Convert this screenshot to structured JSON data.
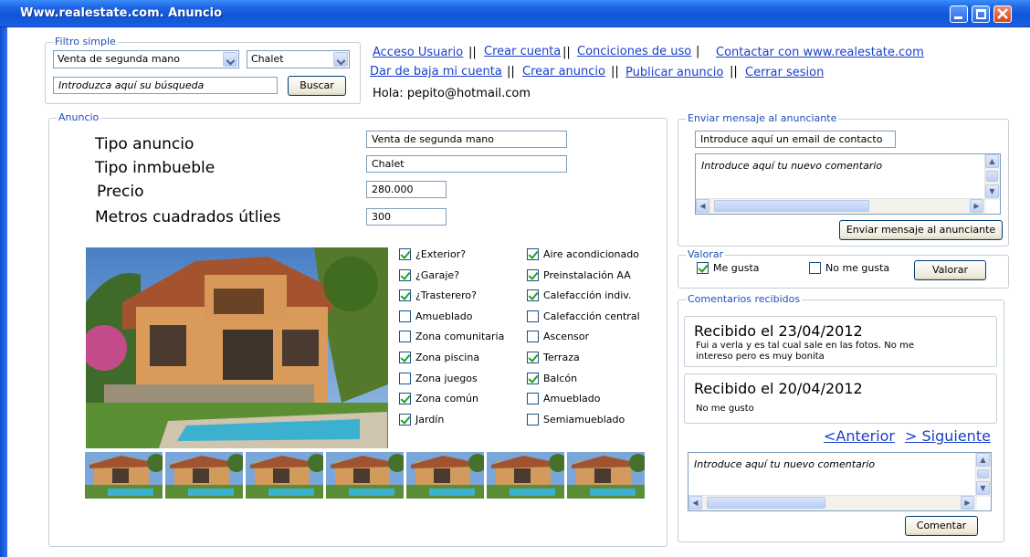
{
  "window": {
    "title": "Www.realestate.com. Anuncio"
  },
  "filter": {
    "legend": "Filtro simple",
    "type_selected": "Venta de segunda mano",
    "property_selected": "Chalet",
    "search_placeholder": "Introduzca aquí su búsqueda",
    "search_button": "Buscar"
  },
  "nav": {
    "links": [
      "Acceso Usuario",
      "Crear cuenta",
      "Conciciones de uso",
      "Contactar con www.realestate.com",
      "Dar de baja mi cuenta",
      "Crear anuncio",
      "Publicar anuncio",
      "Cerrar sesion"
    ],
    "separator": "||",
    "greeting": "Hola: pepito@hotmail.com"
  },
  "ad": {
    "legend": "Anuncio",
    "labels": {
      "tipo_anuncio": "Tipo anuncio",
      "tipo_inmueble": "Tipo inmbueble",
      "precio": "Precio",
      "metros": "Metros cuadrados útlies"
    },
    "values": {
      "tipo_anuncio": "Venta de segunda mano",
      "tipo_inmueble": "Chalet",
      "precio": "280.000",
      "metros": "300"
    },
    "features_left": [
      {
        "label": "¿Exterior?",
        "checked": true
      },
      {
        "label": "¿Garaje?",
        "checked": true
      },
      {
        "label": "¿Trasterero?",
        "checked": true
      },
      {
        "label": "Amueblado",
        "checked": false
      },
      {
        "label": "Zona comunitaria",
        "checked": false
      },
      {
        "label": "Zona piscina",
        "checked": true
      },
      {
        "label": "Zona juegos",
        "checked": false
      },
      {
        "label": "Zona común",
        "checked": true
      },
      {
        "label": "Jardín",
        "checked": true
      }
    ],
    "features_right": [
      {
        "label": "Aire acondicionado",
        "checked": true
      },
      {
        "label": "Preinstalación AA",
        "checked": true
      },
      {
        "label": "Calefacción indiv.",
        "checked": true
      },
      {
        "label": "Calefacción central",
        "checked": false
      },
      {
        "label": "Ascensor",
        "checked": false
      },
      {
        "label": "Terraza",
        "checked": true
      },
      {
        "label": "Balcón",
        "checked": true
      },
      {
        "label": "Amueblado",
        "checked": false
      },
      {
        "label": "Semiamueblado",
        "checked": false
      }
    ],
    "thumbnail_count": 7
  },
  "message": {
    "legend": "Enviar mensaje al anunciante",
    "email_placeholder": "Introduce aquí un email de contacto",
    "comment_placeholder": "Introduce aquí tu nuevo comentario",
    "send_button": "Enviar mensaje al anunciante"
  },
  "rate": {
    "legend": "Valorar",
    "like": {
      "label": "Me gusta",
      "checked": true
    },
    "dislike": {
      "label": "No me gusta",
      "checked": false
    },
    "button": "Valorar"
  },
  "comments": {
    "legend": "Comentarios recibidos",
    "items": [
      {
        "title": "Recibido el 23/04/2012",
        "body": [
          "Fui a verla y es tal cual sale en las fotos. No me",
          "intereso pero es muy bonita"
        ]
      },
      {
        "title": "Recibido el 20/04/2012",
        "body": [
          "No me gusto"
        ]
      }
    ],
    "prev": "<Anterior",
    "next": "> Siguiente",
    "new_placeholder": "Introduce aquí tu nuevo comentario",
    "submit_button": "Comentar"
  },
  "colors": {
    "titlebar": "#1d64e6",
    "link": "#1a3fcb",
    "legend": "#1f4fb6",
    "check": "#21a121"
  }
}
